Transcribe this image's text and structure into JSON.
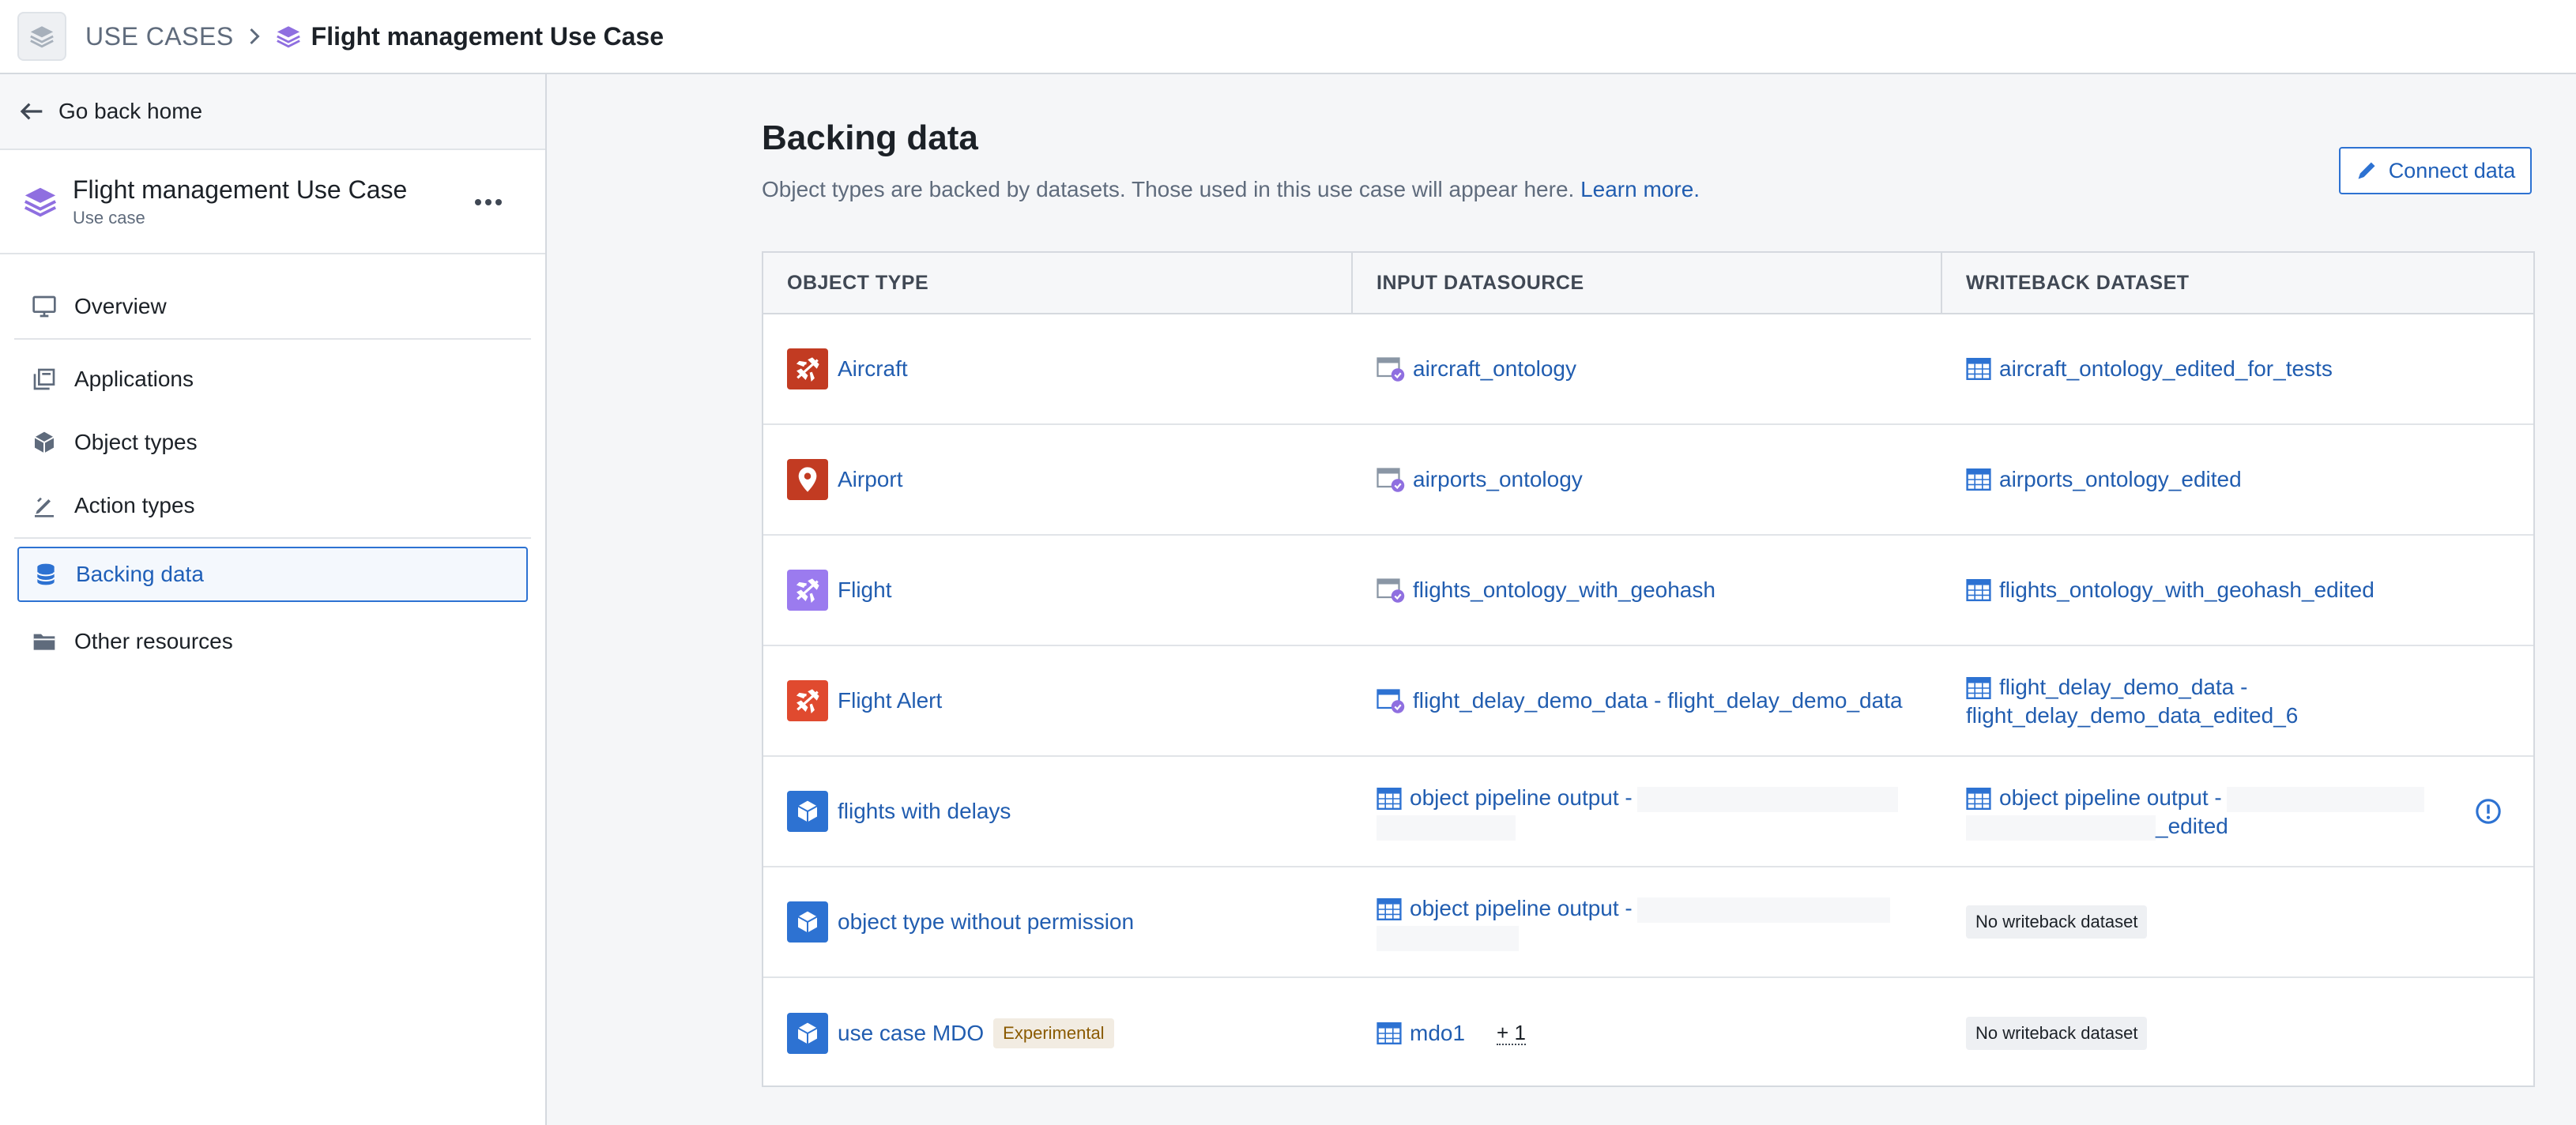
{
  "breadcrumb": {
    "root": "USE CASES",
    "current": "Flight management Use Case"
  },
  "sidebar": {
    "back_label": "Go back home",
    "usecase_title": "Flight management Use Case",
    "usecase_subtitle": "Use case",
    "items": [
      {
        "label": "Overview",
        "icon": "monitor-icon"
      },
      {
        "label": "Applications",
        "icon": "applications-icon"
      },
      {
        "label": "Object types",
        "icon": "cube-icon"
      },
      {
        "label": "Action types",
        "icon": "edit-icon"
      },
      {
        "label": "Backing data",
        "icon": "database-icon",
        "active": true
      },
      {
        "label": "Other resources",
        "icon": "folder-icon"
      }
    ]
  },
  "main": {
    "title": "Backing data",
    "description": "Object types are backed by datasets. Those used in this use case will appear here.",
    "learn_more": "Learn more.",
    "connect_label": "Connect data"
  },
  "table": {
    "headers": [
      "OBJECT TYPE",
      "INPUT DATASOURCE",
      "WRITEBACK DATASET"
    ],
    "rows": [
      {
        "object": "Aircraft",
        "icon": "airplane-icon",
        "icon_color": "#c23b22",
        "input": "aircraft_ontology",
        "input_icon": "dataset-check-icon",
        "writeback": "aircraft_ontology_edited_for_tests"
      },
      {
        "object": "Airport",
        "icon": "map-pin-icon",
        "icon_color": "#c23b22",
        "input": "airports_ontology",
        "input_icon": "dataset-check-icon",
        "writeback": "airports_ontology_edited"
      },
      {
        "object": "Flight",
        "icon": "airplane-icon",
        "icon_color": "#9b7bef",
        "input": "flights_ontology_with_geohash",
        "input_icon": "dataset-check-icon",
        "writeback": "flights_ontology_with_geohash_edited"
      },
      {
        "object": "Flight Alert",
        "icon": "airplane-icon",
        "icon_color": "#e04a2f",
        "input": "flight_delay_demo_data - flight_delay_demo_data",
        "input_icon": "dataset-check-icon",
        "writeback_line1": "flight_delay_demo_data -",
        "writeback_line2": "flight_delay_demo_data_edited_6"
      },
      {
        "object": "flights with delays",
        "icon": "cube-icon",
        "icon_color": "#2d72d2",
        "input": "object pipeline output -",
        "input_icon": "dataset-icon",
        "writeback_line1": "object pipeline output -",
        "writeback_line2": "_edited",
        "warning_icon": "info-circle-icon"
      },
      {
        "object": "object type without permission",
        "icon": "cube-icon",
        "icon_color": "#2d72d2",
        "input": "object pipeline output -",
        "input_icon": "dataset-icon",
        "writeback_none": "No writeback dataset"
      },
      {
        "object": "use case MDO",
        "icon": "cube-icon",
        "icon_color": "#2d72d2",
        "tag": "Experimental",
        "input": "mdo1",
        "input_icon": "dataset-icon",
        "input_extra": "+ 1",
        "writeback_none": "No writeback dataset"
      }
    ]
  }
}
